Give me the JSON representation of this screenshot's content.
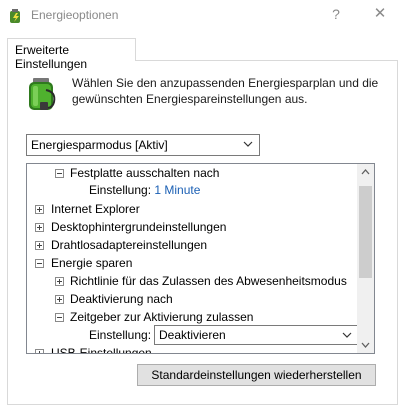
{
  "window": {
    "title": "Energieoptionen",
    "help_glyph": "?",
    "close_glyph": "✕"
  },
  "tab": {
    "label": "Erweiterte Einstellungen"
  },
  "intro": {
    "text": "Wählen Sie den anzupassenden Energiesparplan und die gewünschten Energiespareinstellungen aus."
  },
  "plan": {
    "selected": "Energiesparmodus [Aktiv]"
  },
  "tree": {
    "rows": [
      {
        "label": "Festplatte ausschalten nach"
      },
      {
        "label": "Einstellung:",
        "value": "1 Minute"
      },
      {
        "label": "Internet Explorer"
      },
      {
        "label": "Desktophintergrundeinstellungen"
      },
      {
        "label": "Drahtlosadaptereinstellungen"
      },
      {
        "label": "Energie sparen"
      },
      {
        "label": "Richtlinie für das Zulassen des Abwesenheitsmodus"
      },
      {
        "label": "Deaktivierung nach"
      },
      {
        "label": "Zeitgeber zur Aktivierung zulassen"
      },
      {
        "label": "Einstellung:",
        "value": "Deaktivieren"
      },
      {
        "label": "USB-Einstellungen"
      }
    ]
  },
  "restore_button": {
    "label": "Standardeinstellungen wiederherstellen"
  },
  "colors": {
    "setting_value": "#1a5fb4",
    "title_gray": "#8a8a8a",
    "button_face": "#e1e1e1"
  }
}
